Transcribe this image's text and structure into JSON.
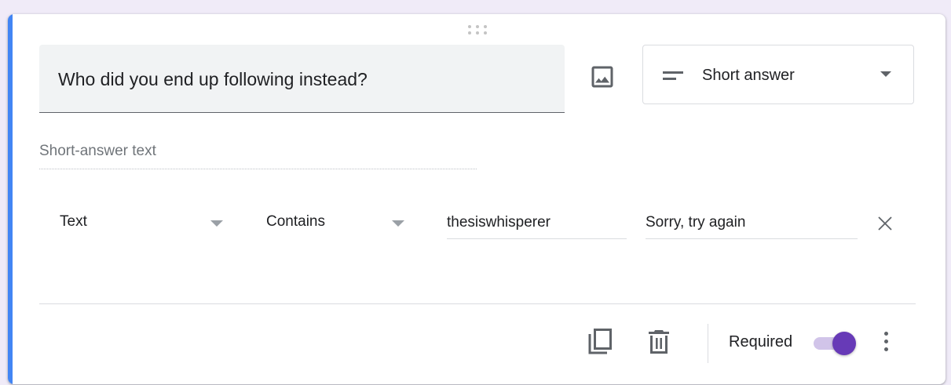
{
  "question": {
    "title": "Who did you end up following instead?",
    "type_label": "Short answer",
    "answer_placeholder": "Short-answer text"
  },
  "validation": {
    "field_type": "Text",
    "condition": "Contains",
    "value": "thesiswhisperer",
    "error_text": "Sorry, try again"
  },
  "footer": {
    "required_label": "Required",
    "required_on": true
  },
  "icons": {
    "drag": "drag-handle-icon",
    "image": "add-image-icon",
    "type": "short-text-icon",
    "dropdown": "dropdown-arrow-icon",
    "remove": "close-icon",
    "duplicate": "duplicate-icon",
    "delete": "trash-icon",
    "more": "more-vert-icon"
  },
  "colors": {
    "accent_bar": "#4285f4",
    "toggle_on": "#673ab7",
    "toggle_track": "#d1c4e9",
    "page_background": "#f0ebf8"
  }
}
